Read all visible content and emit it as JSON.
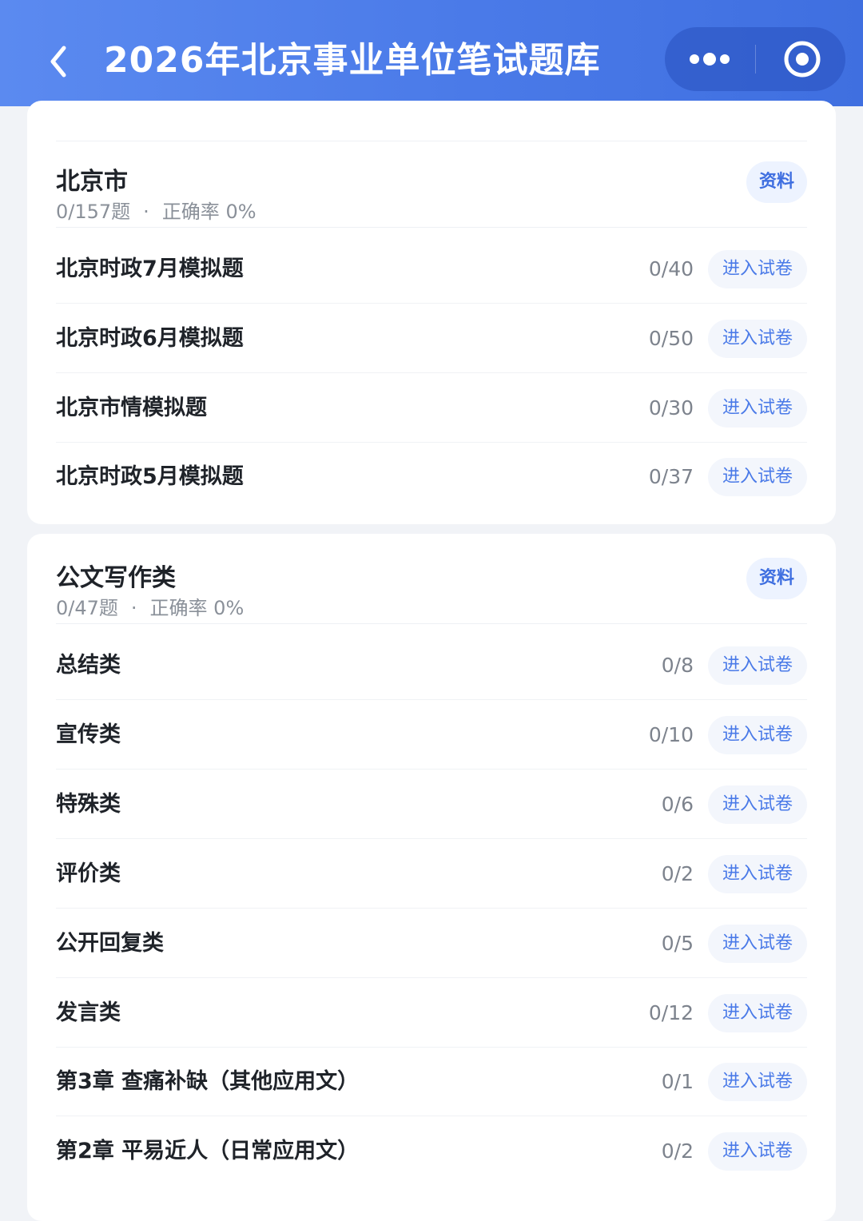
{
  "header": {
    "title": "2026年北京事业单位笔试题库",
    "back_icon": "chevron-left-icon",
    "more_icon": "more-dots-icon",
    "close_icon": "target-circle-icon"
  },
  "sections": [
    {
      "title": "北京市",
      "count": "0/157题",
      "separator": "·",
      "accuracy": "正确率 0%",
      "badge": "资料",
      "items": [
        {
          "name": "北京时政7月模拟题",
          "count": "0/40",
          "action": "进入试卷"
        },
        {
          "name": "北京时政6月模拟题",
          "count": "0/50",
          "action": "进入试卷"
        },
        {
          "name": "北京市情模拟题",
          "count": "0/30",
          "action": "进入试卷"
        },
        {
          "name": "北京时政5月模拟题",
          "count": "0/37",
          "action": "进入试卷"
        }
      ]
    },
    {
      "title": "公文写作类",
      "count": "0/47题",
      "separator": "·",
      "accuracy": "正确率 0%",
      "badge": "资料",
      "items": [
        {
          "name": "总结类",
          "count": "0/8",
          "action": "进入试卷"
        },
        {
          "name": "宣传类",
          "count": "0/10",
          "action": "进入试卷"
        },
        {
          "name": "特殊类",
          "count": "0/6",
          "action": "进入试卷"
        },
        {
          "name": "评价类",
          "count": "0/2",
          "action": "进入试卷"
        },
        {
          "name": "公开回复类",
          "count": "0/5",
          "action": "进入试卷"
        },
        {
          "name": "发言类",
          "count": "0/12",
          "action": "进入试卷"
        },
        {
          "name": "第3章 查痛补缺（其他应用文）",
          "count": "0/1",
          "action": "进入试卷"
        },
        {
          "name": "第2章 平易近人（日常应用文）",
          "count": "0/2",
          "action": "进入试卷"
        }
      ]
    }
  ],
  "colors": {
    "header": "#4a7ae8",
    "accent": "#3f6fe0",
    "background": "#f1f3f7"
  }
}
